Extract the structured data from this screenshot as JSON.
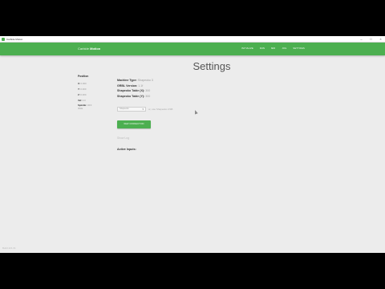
{
  "window": {
    "title": "Carbide Motion",
    "controls": [
      "–",
      "□",
      "×"
    ]
  },
  "navbar": {
    "brand_prefix": "Carbide",
    "brand_name": "Motion",
    "links": [
      "INITIALIZE",
      "RUN",
      "MDI",
      "JOG",
      "SETTINGS"
    ],
    "color": "#4caf50"
  },
  "page": {
    "title": "Settings"
  },
  "position": {
    "heading": "Position",
    "x": {
      "label": "X:",
      "value": "0.000"
    },
    "y": {
      "label": "Y:",
      "value": "0.000"
    },
    "z": {
      "label": "Z:",
      "value": "0.000"
    },
    "units": {
      "label": "Vel:",
      "value": "0.0"
    },
    "spindle": {
      "label": "Spindle:",
      "value": "OFF"
    },
    "status": "IDLE"
  },
  "machine_info": [
    {
      "label": "Machine Type:",
      "value": "Shapeoko 3"
    },
    {
      "label": "GRBL Version:",
      "value": "1.1f"
    },
    {
      "label": "Shapeoko Table (X):",
      "value": "300"
    },
    {
      "label": "Shapeoko Table (Y):",
      "value": "300"
    }
  ],
  "port": {
    "selected": "Shapeoko",
    "hint": "or, use Shapeoko USB"
  },
  "connect_button": "NEW CONNECTION",
  "console_log": "Show Log",
  "active_inputs": "Active Inputs:",
  "build": "Build 421.01"
}
